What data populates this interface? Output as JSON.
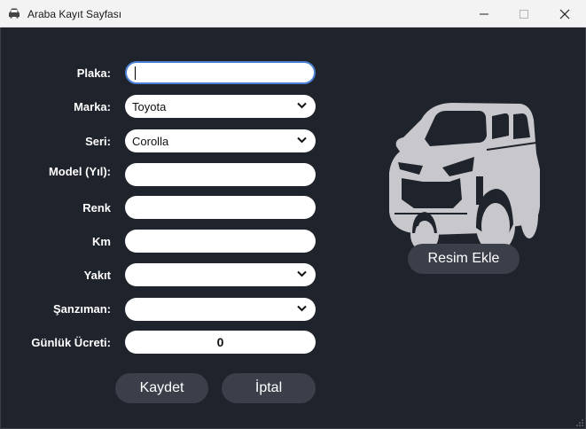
{
  "window": {
    "title": "Araba Kayıt Sayfası"
  },
  "form": {
    "plaka_label": "Plaka:",
    "plaka_value": "",
    "marka_label": "Marka:",
    "marka_value": "Toyota",
    "seri_label": "Seri:",
    "seri_value": "Corolla",
    "model_label": "Model (Yıl):",
    "model_value": "",
    "renk_label": "Renk",
    "renk_value": "",
    "km_label": "Km",
    "km_value": "",
    "yakit_label": "Yakıt",
    "yakit_value": "",
    "sanziman_label": "Şanzıman:",
    "sanziman_value": "",
    "ucret_label": "Günlük Ücreti:",
    "ucret_value": "0"
  },
  "buttons": {
    "kaydet": "Kaydet",
    "iptal": "İptal",
    "resim_ekle": "Resim Ekle"
  },
  "icons": {
    "app": "car-icon",
    "car_image": "car-placeholder-icon",
    "dropdown": "chevron-down-icon"
  },
  "colors": {
    "background": "#1f232c",
    "field": "#ffffff",
    "button": "#3a3f4a",
    "car": "#c8c8cc"
  }
}
